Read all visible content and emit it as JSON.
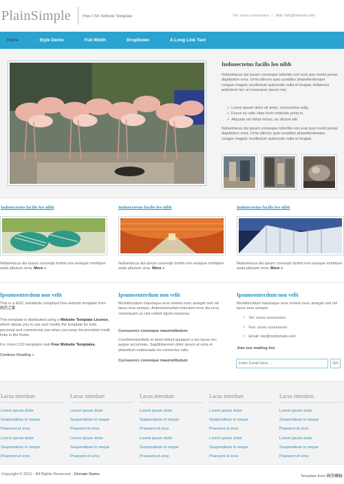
{
  "header": {
    "logo": "PlainSimple",
    "tagline": "Free CSS Website Template",
    "tel": "Tel: xxxxx xxxxxxxxxx",
    "separator": "|",
    "mail": "Mail: info@domain.com"
  },
  "nav": {
    "items": [
      "Home",
      "Style Demo",
      "Full Width",
      "DropDown",
      "A Long Link Text"
    ]
  },
  "feature": {
    "title": "Indonectetus facilis leo nibh",
    "para1": "Nullamlacus dui ipsum conseque loborttis non euis que morbi penas dapibulum orna. Urna ultrices quis curabitur phasellentesque congue magnis vestibulum quismodo nulla et feugiat. Adipiscini pellentum leo ut consequer ipsum nisi.",
    "list": [
      "Lorem ipsum dolor sit amet, consectetur adip.",
      "Fusce eu odio vitae inchi molestie porta in.",
      "Aliquam vel tellus lectus, eu dictum elit."
    ],
    "para2": "Nullamlacus dui ipsum conseque loborttis non euis que morbi penas dapibulum orna. Urna ultrices quis curabitur phasellentesque congue magnis vestibulum quismodo nulla et feugiat."
  },
  "columns": [
    {
      "title": "Indonectetus facilis leo nibh",
      "text": "Nullamlacus dui ipsum conseqlo borttis non euisque morbipen asda pibulum orna.",
      "more": "More »"
    },
    {
      "title": "Indonectetus facilis leo nibh",
      "text": "Nullamlacus dui ipsum conseqlo borttis non euisque morbipen asda pibulum orna.",
      "more": "More »"
    },
    {
      "title": "Indonectetus facilis leo nibh",
      "text": "Nullamlacus dui ipsum conseqlo borttis non euisque morbipen asda pibulum orna.",
      "more": "More »"
    }
  ],
  "section1": {
    "title": "Ipsumsenterdum non velit",
    "p1": "This is a W3C standards compliant free website template from",
    "p1_link": "网页之家",
    "p2_a": "This template is distributed using a",
    "p2_link": "Website Template Licence",
    "p2_b": ", which allows you to use and modify the template for both personal and commercial use when you keep the provided credit links in the footer.",
    "p3_a": "For more CSS templates visit",
    "p3_link": "Free Website Templates",
    "p3_b": ".",
    "continue": "Continue Reading »"
  },
  "section2": {
    "title": "Ipsumsenterdum non velit",
    "p1": "Morbitincidunt maurisque eros molest nunc anteget sed vel lacus mus semper. Anterdumnullam interdum eros dui urna consequam ac nisl nullam ligula vestassa.",
    "h1": "Cursusorci conseque mauristibulum",
    "p2": "Condimentumfelis et amet tellent quisquet a leo lacus nec augue accumsan. Sagittislaorem dolor ipsum at urna et pharetium malesuada nis consectus odio.",
    "h2": "Cursusorci conseque mauristibulum"
  },
  "section3": {
    "title": "Ipsumsenterdum non velit",
    "p1": "Morbitincidunt maurisque eros molest nunc anteget sed vel lacus mus semper.",
    "contacts": [
      "Tel: xxxxx xxxxxxxxxx",
      "Fax: xxxxx xxxxxxxxxx",
      "Email: me@mydomain.com"
    ],
    "mailing_label": "Join our mailing list:",
    "email_placeholder": "Enter Email Here…",
    "go": "GO"
  },
  "footer_links": [
    {
      "title": "Lacus interdum",
      "links": [
        "Lorem ipsum dolor",
        "Suspendisse in neque",
        "Praesent et eros",
        "Lorem ipsum dolor",
        "Suspendisse in neque",
        "Praesent et eros"
      ]
    },
    {
      "title": "Lacus interdum",
      "links": [
        "Lorem ipsum dolor",
        "Suspendisse in neque",
        "Praesent et eros",
        "Lorem ipsum dolor",
        "Suspendisse in neque",
        "Praesent et eros"
      ]
    },
    {
      "title": "Lacus interdum",
      "links": [
        "Lorem ipsum dolor",
        "Suspendisse in neque",
        "Praesent et eros",
        "Lorem ipsum dolor",
        "Suspendisse in neque",
        "Praesent et eros"
      ]
    },
    {
      "title": "Lacus interdum",
      "links": [
        "Lorem ipsum dolor",
        "Suspendisse in neque",
        "Praesent et eros",
        "Lorem ipsum dolor",
        "Suspendisse in neque",
        "Praesent et eros"
      ]
    },
    {
      "title": "Lacus interdum",
      "links": [
        "Lorem ipsum dolor",
        "Suspendisse in neque",
        "Praesent et eros",
        "Lorem ipsum dolor",
        "Suspendisse in neque",
        "Praesent et eros"
      ]
    }
  ],
  "footer": {
    "copyright": "Copyright © 2011 - All Rights Reserved -",
    "domain": "Domain Name",
    "credit": "Template from",
    "credit_link": "网页模板"
  },
  "colors": {
    "accent": "#2aa3d0",
    "link": "#2b8fbf"
  }
}
